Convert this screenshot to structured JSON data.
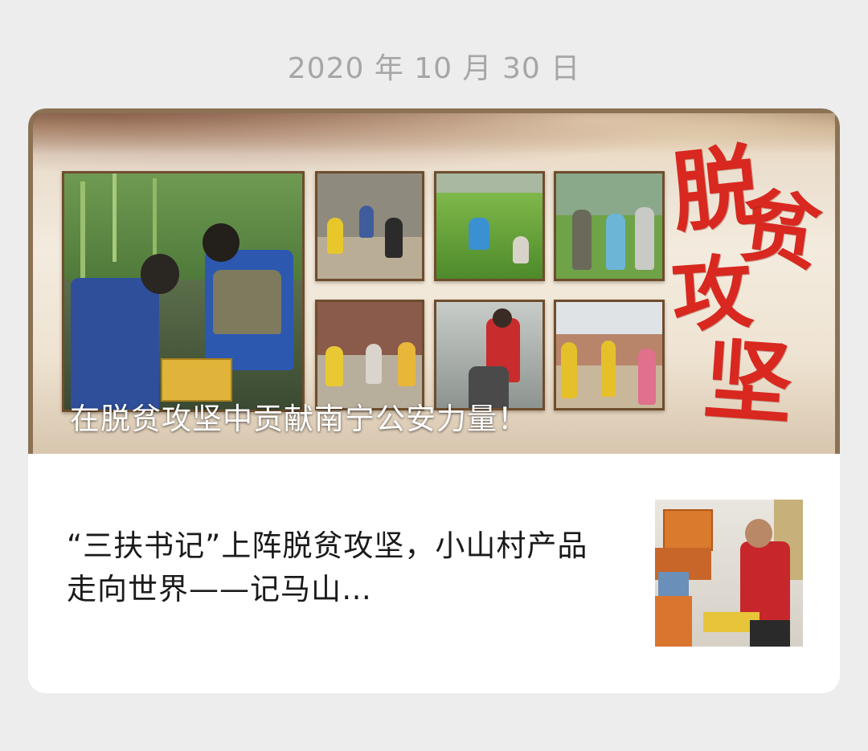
{
  "date": "2020 年 10 月 30 日",
  "banner": {
    "slogan": "在脱贫攻坚中贡献南宁公安力量！",
    "calligraphy": [
      "脱",
      "贫",
      "攻",
      "坚"
    ]
  },
  "article": {
    "title": "“三扶书记”上阵脱贫攻坚，小山村产品走向世界——记马山…"
  },
  "colors": {
    "background": "#ededed",
    "card": "#ffffff",
    "date_text": "#a6a6a6",
    "calligraphy_red": "#d8281f",
    "frame_brown": "#8c7255"
  }
}
